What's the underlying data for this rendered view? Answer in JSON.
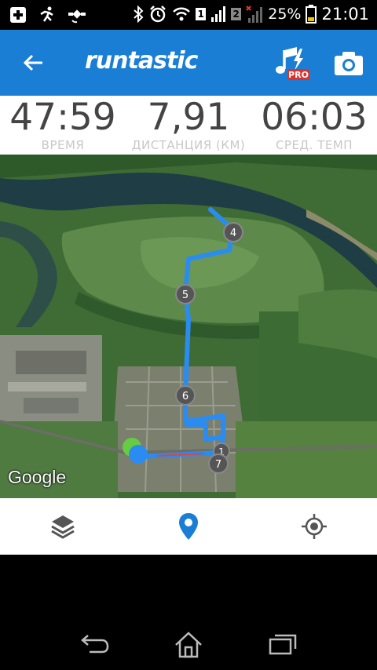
{
  "status_bar": {
    "battery_percent": "25%",
    "time": "21:01",
    "sim1": "1",
    "sim2": "2"
  },
  "app_bar": {
    "logo_text": "runtastic",
    "pro_badge": "PRO"
  },
  "stats": [
    {
      "value": "47:59",
      "label": "ВРЕМЯ"
    },
    {
      "value": "7,91",
      "label": "ДИСТАНЦИЯ (КМ)"
    },
    {
      "value": "06:03",
      "label": "СРЕД. ТЕМП"
    }
  ],
  "map": {
    "attribution": "Google",
    "km_markers": [
      "1",
      "4",
      "5",
      "6",
      "7"
    ]
  },
  "colors": {
    "accent": "#1a7fd4",
    "route": "#2a8cf0",
    "start": "#66cc44"
  },
  "bottom_tabs": [
    "layers-icon",
    "location-pin-icon",
    "my-location-icon"
  ],
  "nav_buttons": [
    "back-icon",
    "home-icon",
    "recent-apps-icon"
  ]
}
